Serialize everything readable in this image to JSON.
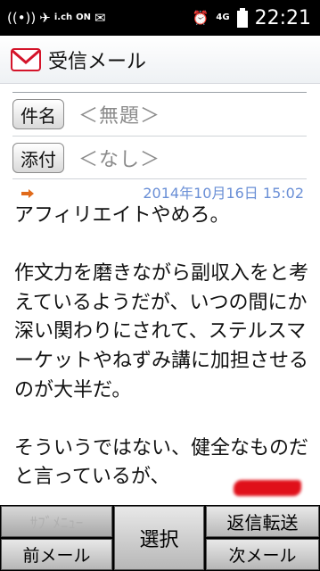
{
  "status_bar": {
    "icons": [
      "signal-icon",
      "satellite-icon",
      "ichannel-icon",
      "nfc-icon",
      "mail-notify-icon",
      "alarm-icon",
      "lte-signal-icon",
      "battery-icon"
    ],
    "ichannel_text": "i.ch",
    "nfc_text": "ON",
    "network_text": "4G",
    "time": "22:21"
  },
  "header": {
    "title": "受信メール"
  },
  "meta": {
    "subject_label": "件名",
    "subject_value": "＜無題＞",
    "attachment_label": "添付",
    "attachment_value": "＜なし＞"
  },
  "message": {
    "date": "2014年10月16日 15:02",
    "body": "アフィリエイトやめろ。\n\n作文力を磨きながら副収入をと考えているようだが、いつの間にか深い関わりにされて、ステルスマーケットやねずみ講に加担させるのが大半だ。\n\nそういうではない、健全なものだと言っているが、"
  },
  "softkeys": {
    "sub_menu": "ｻﾌﾞﾒﾆｭｰ",
    "prev_mail": "前メール",
    "select": "選択",
    "reply_forward": "返信転送",
    "next_mail": "次メール"
  },
  "colors": {
    "date": "#6a8fd6",
    "redaction": "#e0101a",
    "accent_mail": "#d4142a"
  }
}
